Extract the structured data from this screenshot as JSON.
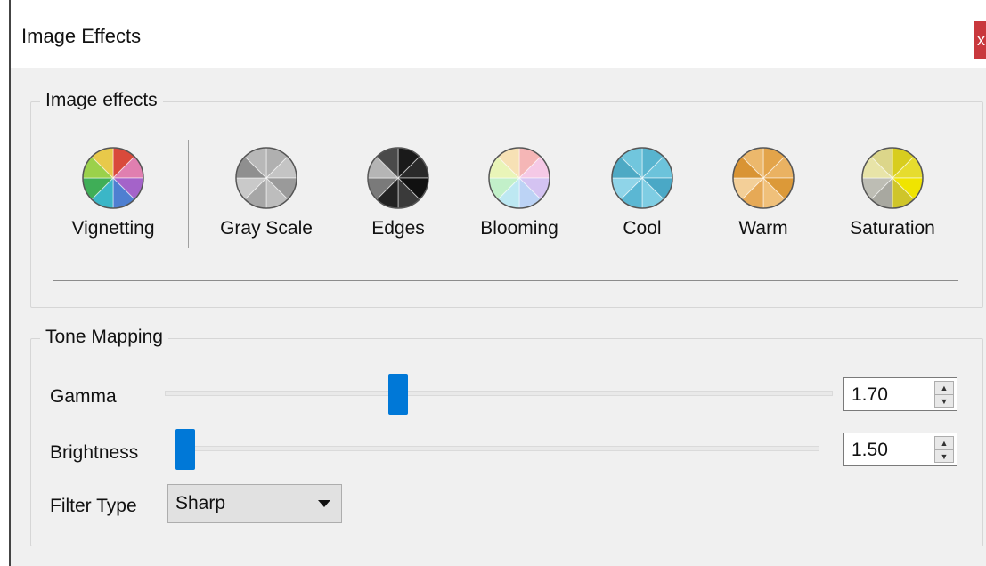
{
  "window": {
    "title": "Image Effects",
    "close_label": "x"
  },
  "effects_group": {
    "title": "Image effects",
    "items": [
      {
        "label": "Vignetting",
        "icon": "vignetting-icon",
        "colors": [
          "#d94a3b",
          "#e07fb0",
          "#a463c9",
          "#4e7fd1",
          "#3bb6c7",
          "#3fae57",
          "#9bd14b",
          "#e8c94a"
        ]
      },
      {
        "label": "Gray Scale",
        "icon": "grayscale-icon",
        "colors": [
          "#b0b0b0",
          "#c4c4c4",
          "#9a9a9a",
          "#bdbdbd",
          "#a6a6a6",
          "#c9c9c9",
          "#8f8f8f",
          "#b8b8b8"
        ]
      },
      {
        "label": "Edges",
        "icon": "edges-icon",
        "colors": [
          "#1a1a1a",
          "#2a2a2a",
          "#111111",
          "#3a3a3a",
          "#222222",
          "#7a7a7a",
          "#b5b5b5",
          "#4a4a4a"
        ]
      },
      {
        "label": "Blooming",
        "icon": "blooming-icon",
        "colors": [
          "#f5b6b6",
          "#f5c9e6",
          "#d4c3f2",
          "#bcd3f5",
          "#bde8f2",
          "#c2f0c9",
          "#e9f5b8",
          "#f7e1b5"
        ]
      },
      {
        "label": "Cool",
        "icon": "cool-icon",
        "colors": [
          "#58b4cf",
          "#6cc3db",
          "#4aa8c6",
          "#7fcde3",
          "#5bb7d3",
          "#8fd4e8",
          "#4ea9c4",
          "#71c6dd"
        ]
      },
      {
        "label": "Warm",
        "icon": "warm-icon",
        "colors": [
          "#e3a44a",
          "#eab262",
          "#dc9938",
          "#f0c07a",
          "#e6a956",
          "#f3cf98",
          "#d99434",
          "#ecb86c"
        ]
      },
      {
        "label": "Saturation",
        "icon": "saturation-icon",
        "colors": [
          "#d8cd1e",
          "#e6dc2e",
          "#f0e400",
          "#cfc52a",
          "#a8a8a0",
          "#bdbdb4",
          "#e8e4a8",
          "#dcd68a"
        ]
      }
    ]
  },
  "tone_group": {
    "title": "Tone Mapping",
    "gamma": {
      "label": "Gamma",
      "value": "1.70",
      "slider_fraction": 0.345
    },
    "brightness": {
      "label": "Brightness",
      "value": "1.50",
      "slider_fraction": 0.0
    },
    "filter": {
      "label": "Filter Type",
      "selected": "Sharp"
    }
  },
  "colors": {
    "accent": "#0078d7",
    "close": "#c9383d"
  }
}
